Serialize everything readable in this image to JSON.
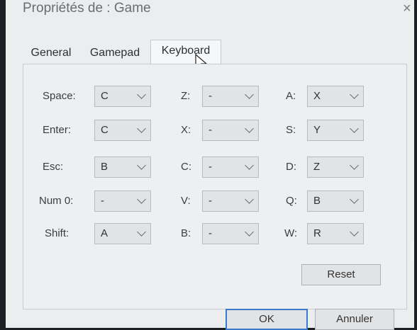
{
  "dialog": {
    "title": "Propriétés de : Game",
    "close_glyph": "×"
  },
  "tabs": [
    {
      "label": "General",
      "active": false
    },
    {
      "label": "Gamepad",
      "active": false
    },
    {
      "label": "Keyboard",
      "active": true
    }
  ],
  "keyboard": {
    "col1": [
      {
        "label": "Space:",
        "value": "C"
      },
      {
        "label": "Enter:",
        "value": "C"
      },
      {
        "label": "Esc:",
        "value": "B"
      },
      {
        "label": "Num 0:",
        "value": "-"
      },
      {
        "label": "Shift:",
        "value": "A"
      }
    ],
    "col2": [
      {
        "label": "Z:",
        "value": "-"
      },
      {
        "label": "X:",
        "value": "-"
      },
      {
        "label": "C:",
        "value": "-"
      },
      {
        "label": "V:",
        "value": "-"
      },
      {
        "label": "B:",
        "value": "-"
      }
    ],
    "col3": [
      {
        "label": "A:",
        "value": "X"
      },
      {
        "label": "S:",
        "value": "Y"
      },
      {
        "label": "D:",
        "value": "Z"
      },
      {
        "label": "Q:",
        "value": "B"
      },
      {
        "label": "W:",
        "value": "R"
      }
    ]
  },
  "buttons": {
    "reset": "Reset",
    "ok": "OK",
    "cancel": "Annuler"
  },
  "icons": {
    "close": "close-icon",
    "dropdown": "chevron-down-icon",
    "cursor": "mouse-pointer-icon"
  },
  "colors": {
    "accent": "#3a78c8"
  }
}
